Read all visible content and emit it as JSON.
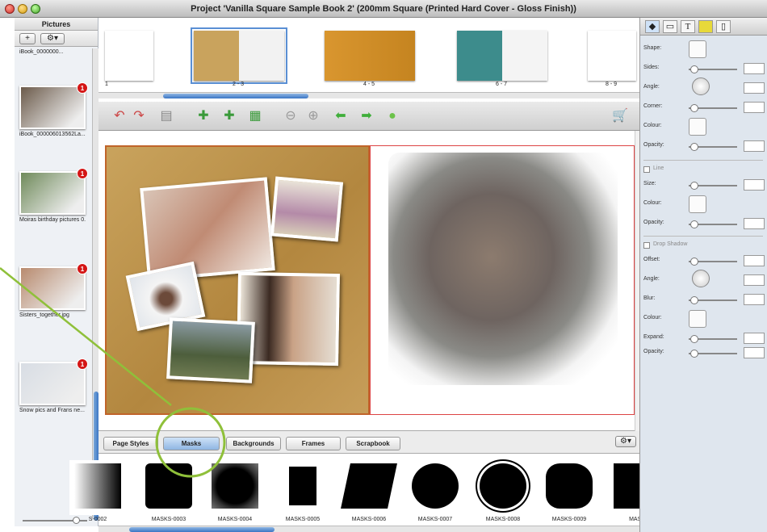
{
  "window": {
    "title": "Project 'Vanilla Square Sample Book 2' (200mm Square (Printed Hard Cover - Gloss Finish))"
  },
  "pictures_panel": {
    "heading": "Pictures",
    "add_label": "+",
    "gear_label": "⚙▾",
    "truncated_top_label": "iBook_0000000...",
    "items": [
      {
        "caption": "iBook_000006013562La...",
        "badge": "1",
        "color": "#6b5a4a"
      },
      {
        "caption": "Moiras birthday pictures 0...",
        "badge": "1",
        "color": "#6f8a5a"
      },
      {
        "caption": "Sisters_together.jpg",
        "badge": "1",
        "color": "#b88a6e"
      },
      {
        "caption": "Snow pics and Frans ne...",
        "badge": "1",
        "color": "#d8dde4"
      }
    ]
  },
  "spreads": [
    {
      "label": "1",
      "style": "blank"
    },
    {
      "label": "2 - 3",
      "style": "collage-selected"
    },
    {
      "label": "4 - 5",
      "style": "orange"
    },
    {
      "label": "6 - 7",
      "style": "teal"
    },
    {
      "label": "8 - 9",
      "style": "blank"
    }
  ],
  "toolbar": {
    "icons": [
      "undo-icon",
      "redo-icon",
      "trash-icon",
      "add-text-icon",
      "add-picture-icon",
      "add-page-icon",
      "zoom-out-icon",
      "zoom-in-icon",
      "back-arrow-icon",
      "forward-arrow-icon",
      "go-icon",
      "cart-icon"
    ]
  },
  "tabs": [
    {
      "label": "Page Styles",
      "active": false
    },
    {
      "label": "Masks",
      "active": true
    },
    {
      "label": "Backgrounds",
      "active": false
    },
    {
      "label": "Frames",
      "active": false
    },
    {
      "label": "Scrapbook",
      "active": false
    }
  ],
  "tab_gear_label": "⚙▾",
  "masks": [
    {
      "label": "S-0002",
      "shape": "gradient"
    },
    {
      "label": "MASKS-0003",
      "shape": "rough-square"
    },
    {
      "label": "MASKS-0004",
      "shape": "grunge-square"
    },
    {
      "label": "MASKS-0005",
      "shape": "small-square"
    },
    {
      "label": "MASKS-0006",
      "shape": "brush"
    },
    {
      "label": "MASKS-0007",
      "shape": "rough-circle"
    },
    {
      "label": "MASKS-0008",
      "shape": "sun-circle"
    },
    {
      "label": "MASKS-0009",
      "shape": "rough-blob"
    },
    {
      "label": "MASK",
      "shape": "partial"
    }
  ],
  "properties": {
    "tabs": [
      "shape-tab-icon",
      "frame-tab-icon",
      "T",
      "ruler-tab-icon",
      "page-tab-icon"
    ],
    "shape": {
      "shape": "Shape:",
      "sides": "Sides:",
      "angle": "Angle:",
      "corner": "Corner:",
      "colour": "Colour:",
      "opacity": "Opacity:"
    },
    "line": {
      "section": "Line",
      "size": "Size:",
      "colour": "Colour:",
      "opacity": "Opacity:"
    },
    "shadow": {
      "section": "Drop Shadow",
      "offset": "Offset:",
      "angle": "Angle:",
      "blur": "Blur:",
      "colour": "Colour:",
      "expand": "Expand:",
      "opacity": "Opacity:"
    }
  },
  "colors": {
    "accent": "#3a75c4",
    "badge": "#d41616",
    "annotation": "#8fc03a",
    "left_page": "#c9a35d"
  }
}
